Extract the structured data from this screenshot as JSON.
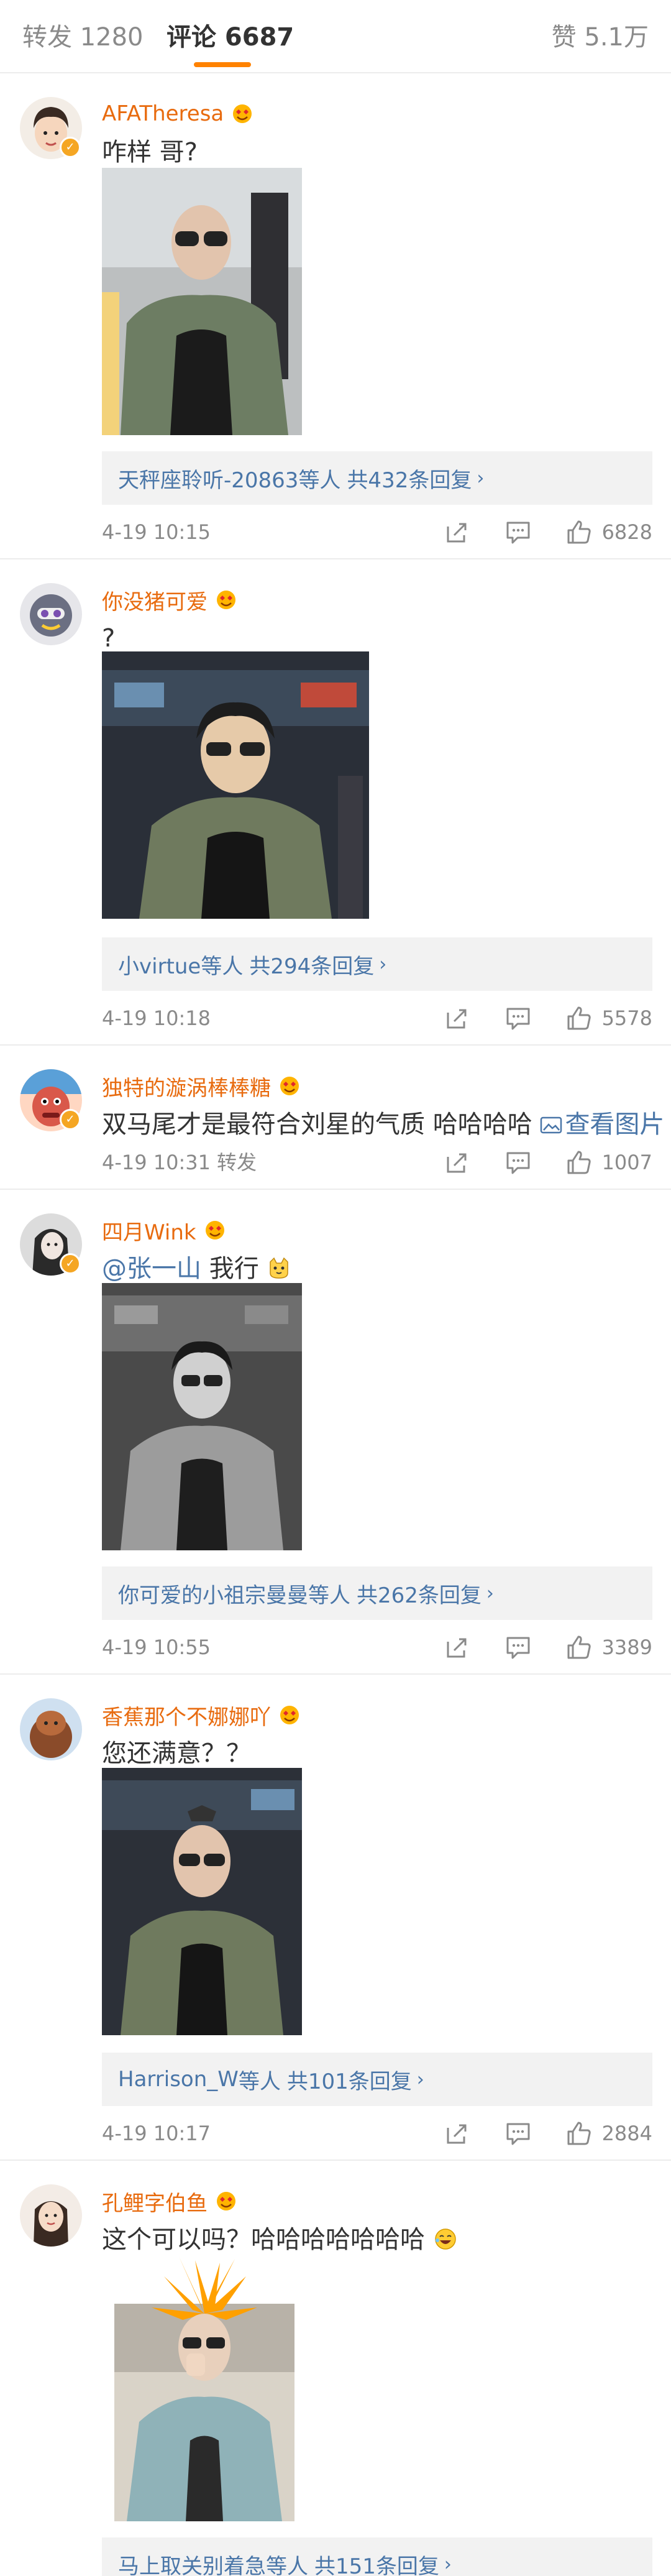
{
  "tabs": {
    "repost": "转发 1280",
    "comments": "评论 6687",
    "likes": "赞 5.1万"
  },
  "colors": {
    "accent": "#ff8200",
    "username": "#e86b0f",
    "link": "#4a76a8",
    "muted": "#8a8a8a"
  },
  "comments": [
    {
      "username": "AFATheresa",
      "verified": true,
      "text": "咋样 哥?",
      "has_photo": true,
      "replies_user": "天秤座聆听-20863",
      "replies_suffix": "等人",
      "replies_total": "共432条回复",
      "time": "4-19 10:15",
      "likes": "6828"
    },
    {
      "username": "你没猪可爱",
      "verified": false,
      "text": "?",
      "has_photo": true,
      "replies_user": "小virtue",
      "replies_suffix": "等人",
      "replies_total": "共294条回复",
      "time": "4-19 10:18",
      "likes": "5578"
    },
    {
      "username": "独特的漩涡棒棒糖",
      "verified": true,
      "text": "双马尾才是最符合刘星的气质 哈哈哈哈 ",
      "view_pic": "查看图片",
      "has_photo": false,
      "time": "4-19 10:31",
      "repost_label": "转发",
      "likes": "1007"
    },
    {
      "username": "四月Wink",
      "verified": true,
      "mention": "@张一山",
      "text": " 我行",
      "has_photo": true,
      "replies_user": "你可爱的小祖宗曼曼",
      "replies_suffix": "等人",
      "replies_total": "共262条回复",
      "time": "4-19 10:55",
      "likes": "3389"
    },
    {
      "username": "香蕉那个不娜娜吖",
      "verified": false,
      "text": "您还满意？？",
      "has_photo": true,
      "replies_user": "Harrison_W",
      "replies_suffix": "等人",
      "replies_total": "共101条回复",
      "time": "4-19 10:17",
      "likes": "2884"
    },
    {
      "username": "孔鲤字伯鱼",
      "verified": false,
      "text": "这个可以吗？哈哈哈哈哈哈哈",
      "has_photo": true,
      "replies_user": "马上取关别着急",
      "replies_suffix": "等人",
      "replies_total": "共151条回复"
    }
  ],
  "icons": {
    "share": "share-icon",
    "comment": "comment-icon",
    "like": "thumbs-up-icon",
    "fan": "heart-eyes-emoji-icon",
    "verified": "verified-badge-icon",
    "picture": "picture-icon",
    "chevron": "chevron-right-icon"
  }
}
